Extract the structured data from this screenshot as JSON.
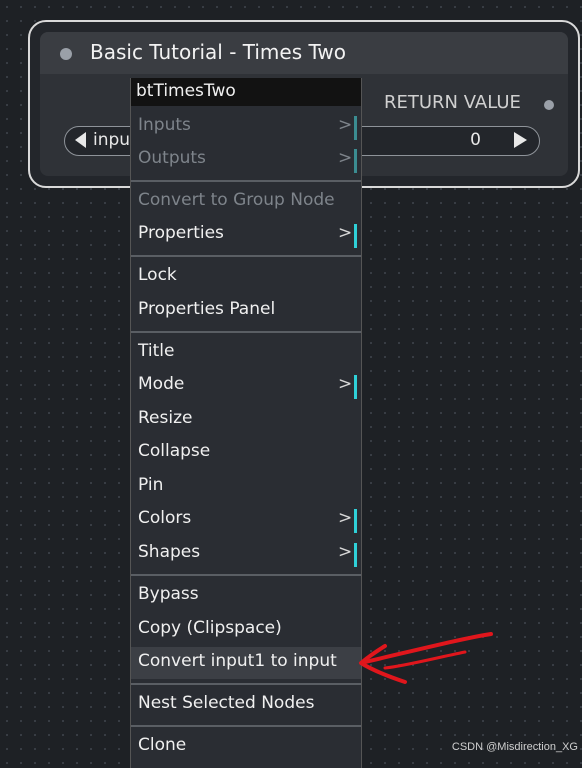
{
  "node": {
    "title": "Basic Tutorial - Times Two",
    "output_label": "RETURN VALUE",
    "widget": {
      "label": "inpu",
      "value": "0"
    }
  },
  "menu": {
    "header": "btTimesTwo",
    "items": [
      {
        "label": "Inputs",
        "disabled": true,
        "submenu": ">"
      },
      {
        "label": "Outputs",
        "disabled": true,
        "submenu": ">"
      },
      {
        "label": "Convert to Group Node",
        "disabled": true
      },
      {
        "label": "Properties",
        "submenu": ">"
      },
      {
        "label": "Lock"
      },
      {
        "label": "Properties Panel"
      },
      {
        "label": "Title"
      },
      {
        "label": "Mode",
        "submenu": ">"
      },
      {
        "label": "Resize"
      },
      {
        "label": "Collapse"
      },
      {
        "label": "Pin"
      },
      {
        "label": "Colors",
        "submenu": ">"
      },
      {
        "label": "Shapes",
        "submenu": ">"
      },
      {
        "label": "Bypass"
      },
      {
        "label": "Copy (Clipspace)"
      },
      {
        "label": "Convert input1 to input",
        "highlighted": true
      },
      {
        "label": "Nest Selected Nodes"
      },
      {
        "label": "Clone"
      }
    ]
  },
  "annotation": {
    "color": "#e0161c"
  },
  "colors": {
    "submenu_accent": "#2fd0d8",
    "canvas_bg": "#1e2125"
  },
  "watermark": "CSDN @Misdirection_XG"
}
